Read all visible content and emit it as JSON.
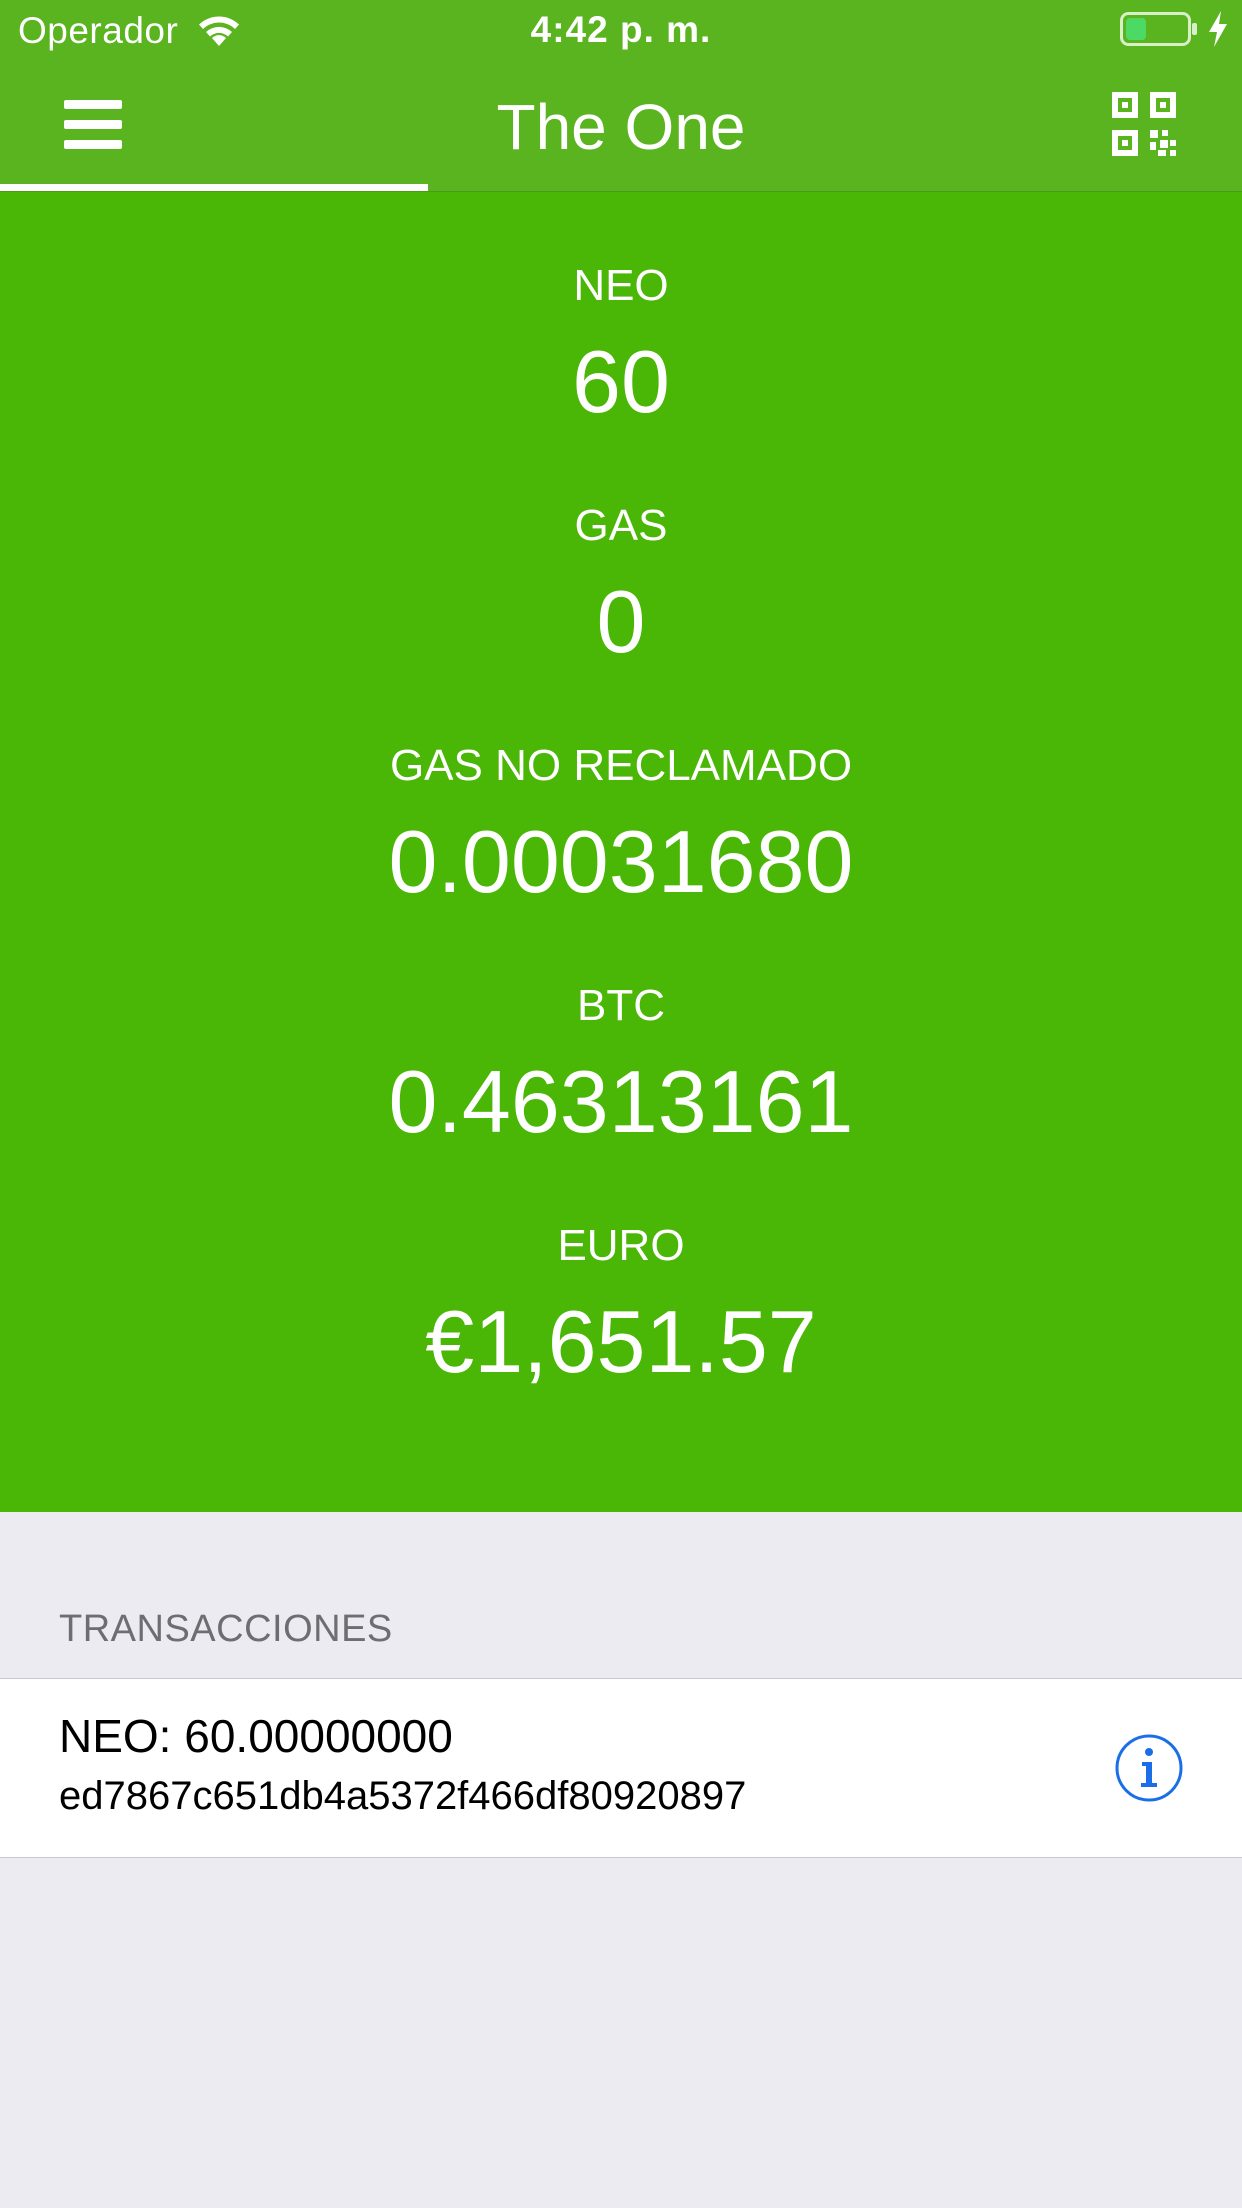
{
  "status_bar": {
    "carrier": "Operador",
    "time": "4:42 p. m.",
    "battery_level": 0.3,
    "charging": true
  },
  "nav": {
    "title": "The One",
    "menu_icon": "hamburger-menu-icon",
    "qr_icon": "qr-code-icon",
    "bar_color": "#59b41f"
  },
  "balances": [
    {
      "label": "NEO",
      "value": "60"
    },
    {
      "label": "GAS",
      "value": "0"
    },
    {
      "label": "GAS NO RECLAMADO",
      "value": "0.00031680"
    },
    {
      "label": "BTC",
      "value": "0.46313161"
    },
    {
      "label": "EURO",
      "value": "€1,651.57"
    }
  ],
  "balance_panel_color": "#4ab605",
  "transactions": {
    "header": "TRANSACCIONES",
    "items": [
      {
        "amount": "NEO: 60.00000000",
        "hash": "ed7867c651db4a5372f466df80920897",
        "action_icon": "info-circle-icon"
      }
    ]
  },
  "colors": {
    "accent_blue": "#1a6fe8",
    "background": "#ebebf1"
  }
}
